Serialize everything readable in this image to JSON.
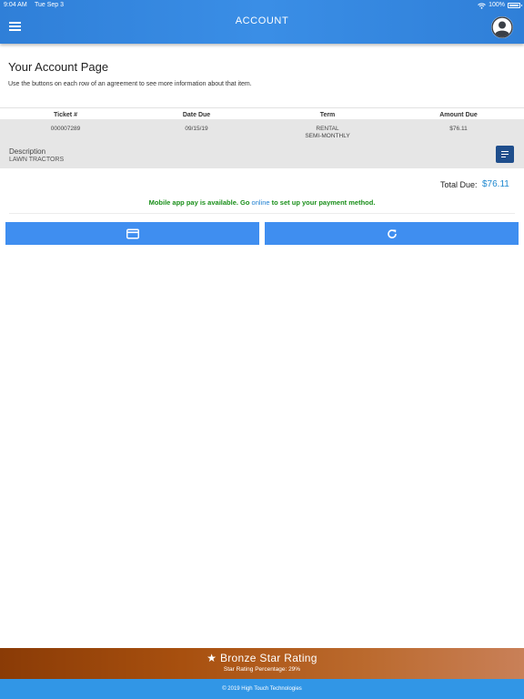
{
  "status_bar": {
    "time": "9:04 AM",
    "date": "Tue Sep 3",
    "battery": "100%"
  },
  "header": {
    "title": "ACCOUNT",
    "menu_icon": "hamburger-menu-icon",
    "profile_icon": "user-avatar-icon"
  },
  "page": {
    "title": "Your Account Page",
    "subtitle": "Use the buttons on each row of an agreement to see more information about that item."
  },
  "table": {
    "headers": [
      "Ticket #",
      "Date Due",
      "Term",
      "Amount Due"
    ],
    "rows": [
      {
        "ticket": "000007289",
        "date_due": "09/15/19",
        "term_line1": "RENTAL",
        "term_line2": "SEMI-MONTHLY",
        "amount_due": "$76.11",
        "description_label": "Description",
        "description": "LAWN TRACTORS"
      }
    ]
  },
  "totals": {
    "label": "Total Due:",
    "value": "$76.11"
  },
  "mobile_pay": {
    "before": "Mobile app pay is available. Go ",
    "link": "online",
    "after": " to set up your payment method."
  },
  "actions": {
    "pay_icon": "credit-card-icon",
    "refresh_icon": "refresh-icon"
  },
  "footer": {
    "rating_title": "★ Bronze Star Rating",
    "rating_percentage": "Star Rating Percentage: 29%",
    "copyright": "© 2019 High Touch Technologies"
  },
  "colors": {
    "header": "#3a8ee6",
    "action_button": "#3f8ef0",
    "detail_button": "#1f4e8c",
    "total_value": "#1e88d0",
    "mobile_pay_text": "#1a8f1a",
    "rating_banner": "#a8500f",
    "copyright_bar": "#3196e6"
  }
}
